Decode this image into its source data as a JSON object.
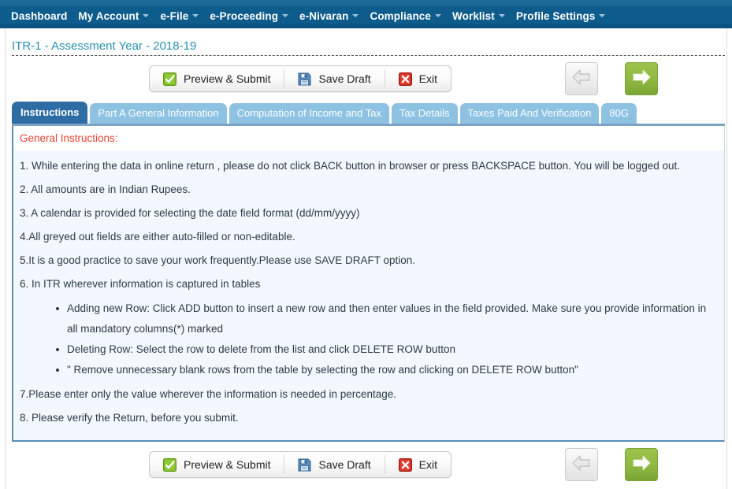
{
  "navbar": {
    "items": [
      {
        "label": "Dashboard",
        "caret": false
      },
      {
        "label": "My Account",
        "caret": true
      },
      {
        "label": "e-File",
        "caret": true
      },
      {
        "label": "e-Proceeding",
        "caret": true
      },
      {
        "label": "e-Nivaran",
        "caret": true
      },
      {
        "label": "Compliance",
        "caret": true
      },
      {
        "label": "Worklist",
        "caret": true
      },
      {
        "label": "Profile Settings",
        "caret": true
      }
    ]
  },
  "form": {
    "title": "ITR-1 - Assessment Year - 2018-19"
  },
  "toolbar": {
    "preview_submit_label": "Preview & Submit",
    "save_draft_label": "Save Draft",
    "exit_label": "Exit",
    "prev_icon": "arrow-left-icon",
    "next_icon": "arrow-right-icon",
    "preview_icon": "green-checkbox-icon",
    "save_icon": "floppy-disk-icon",
    "exit_icon": "red-x-icon"
  },
  "tabs": [
    {
      "label": "Instructions",
      "active": true
    },
    {
      "label": "Part A General Information",
      "active": false
    },
    {
      "label": "Computation of Income and Tax",
      "active": false
    },
    {
      "label": "Tax Details",
      "active": false
    },
    {
      "label": "Taxes Paid And Verification",
      "active": false
    },
    {
      "label": "80G",
      "active": false
    }
  ],
  "instructions": {
    "heading": "General Instructions:",
    "items": [
      "1. While entering the data in online return , please do not click BACK button in browser or press BACKSPACE button. You will be logged out.",
      "2. All amounts are in Indian Rupees.",
      "3. A calendar is provided for selecting the date field format (dd/mm/yyyy)",
      "4.All greyed out fields are either auto-filled or non-editable.",
      "5.It is a good practice to save your work frequently.Please use SAVE DRAFT option.",
      "6. In ITR wherever information is captured in tables"
    ],
    "sub_items": [
      "Adding new Row: Click ADD button to insert a new row and then enter values in the field provided. Make sure you provide information in all mandatory columns(*) marked",
      "Deleting Row: Select the row to delete from the list and click DELETE ROW button",
      "\" Remove unnecessary blank rows from the table by selecting the row and clicking on DELETE ROW button\""
    ],
    "items_after": [
      "7.Please enter only the value wherever the information is needed in percentage.",
      "8. Please verify the Return, before you submit."
    ]
  },
  "colors": {
    "navbar_bg": "#0e5c8c",
    "title_text": "#2a8fb5",
    "heading_red": "#ef4030",
    "tab_active": "#2e6da4",
    "tab_inactive": "#8dc2e3",
    "panel_bg": "#f2f8fd",
    "next_green": "#8fb842"
  }
}
